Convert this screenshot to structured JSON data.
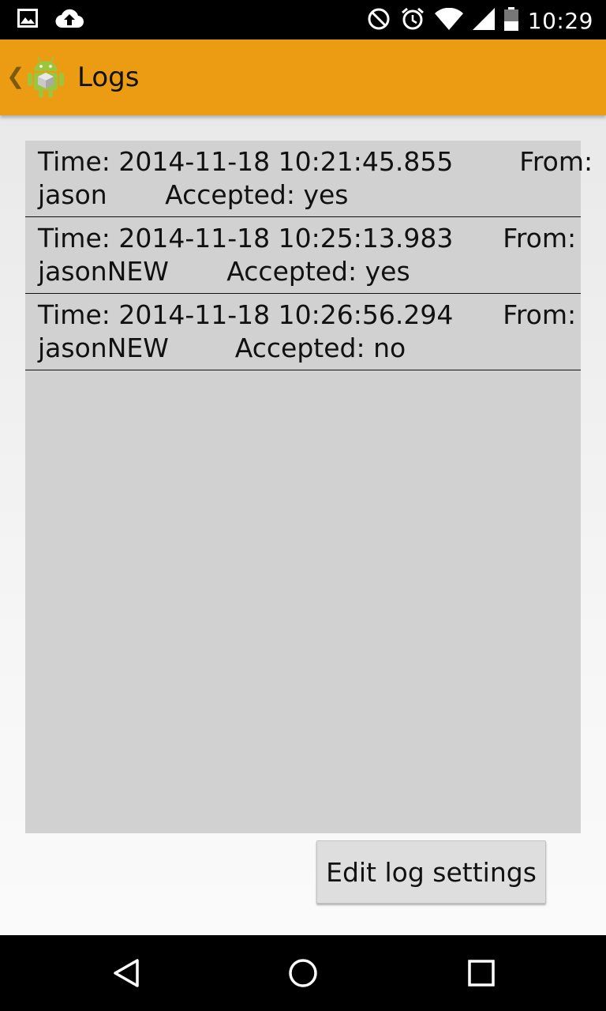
{
  "status_bar": {
    "time": "10:29",
    "left_icons": [
      "image-icon",
      "cloud-upload-icon"
    ],
    "right_icons": [
      "do-not-disturb-icon",
      "alarm-icon",
      "wifi-icon",
      "cell-signal-icon",
      "battery-icon"
    ]
  },
  "app_bar": {
    "title": "Logs",
    "back_glyph": "❮",
    "icon": "android-app-icon",
    "color": "#EC9C12"
  },
  "logs": [
    {
      "line1": "Time: 2014-11-18 10:21:45.855        From:",
      "line2": "jason       Accepted: yes"
    },
    {
      "line1": "Time: 2014-11-18 10:25:13.983      From:",
      "line2": "jasonNEW       Accepted: yes"
    },
    {
      "line1": "Time: 2014-11-18 10:26:56.294      From:",
      "line2": "jasonNEW        Accepted: no"
    }
  ],
  "buttons": {
    "edit_log_settings": "Edit log settings"
  },
  "nav_bar": {
    "icons": [
      "back-icon",
      "home-icon",
      "recents-icon"
    ]
  }
}
